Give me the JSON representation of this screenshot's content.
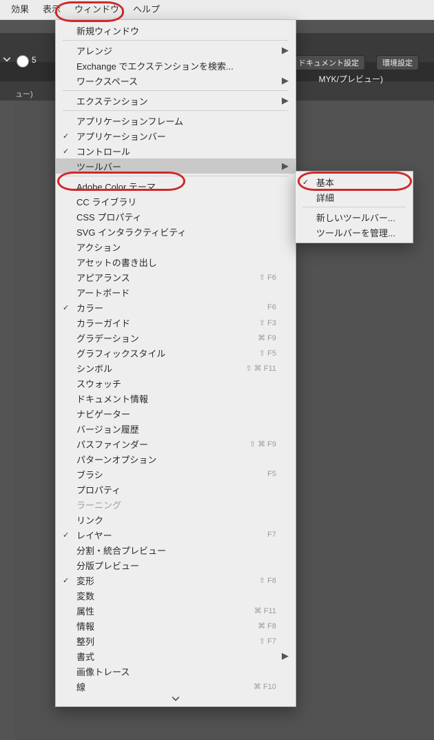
{
  "menubar": {
    "items": [
      "効果",
      "表示",
      "ウィンドウ",
      "ヘルプ"
    ]
  },
  "bg": {
    "doc_setting_btn": "ドキュメント設定",
    "pref_btn": "環境設定",
    "doc_title": "MYK/プレビュー)",
    "tab_text": "ュー)",
    "strok_val": "5"
  },
  "menu": {
    "new_window": "新規ウィンドウ",
    "arrange": "アレンジ",
    "ext_search": "Exchange でエクステンションを検索...",
    "workspace": "ワークスペース",
    "extensions": "エクステンション",
    "app_frame": "アプリケーションフレーム",
    "app_bar": "アプリケーションバー",
    "control": "コントロール",
    "toolbar": "ツールバー",
    "adobe_color": "Adobe Color テーマ",
    "cc_lib": "CC ライブラリ",
    "css_prop": "CSS プロパティ",
    "svg_interactivity": "SVG インタラクティビティ",
    "action": "アクション",
    "asset_export": "アセットの書き出し",
    "appearance": "アピアランス",
    "artboard": "アートボード",
    "color": "カラー",
    "color_guide": "カラーガイド",
    "gradation": "グラデーション",
    "graphic_style": "グラフィックスタイル",
    "symbol": "シンボル",
    "swatch": "スウォッチ",
    "doc_info": "ドキュメント情報",
    "navigator": "ナビゲーター",
    "version_history": "バージョン履歴",
    "pathfinder": "パスファインダー",
    "pattern_option": "パターンオプション",
    "brush": "ブラシ",
    "property": "プロパティ",
    "learning": "ラーニング",
    "link": "リンク",
    "layer": "レイヤー",
    "split_preview": "分割・統合プレビュー",
    "separation_preview": "分版プレビュー",
    "transform": "変形",
    "variables": "変数",
    "attribute": "属性",
    "info": "情報",
    "align": "整列",
    "type": "書式",
    "image_trace": "画像トレース",
    "line": "線",
    "shortcut": {
      "appearance": "⇧ F6",
      "color": "F6",
      "color_guide": "⇧ F3",
      "gradation": "⌘ F9",
      "graphic_style": "⇧ F5",
      "symbol": "⇧ ⌘ F11",
      "pathfinder": "⇧ ⌘ F9",
      "brush": "F5",
      "layer": "F7",
      "transform": "⇧ F8",
      "attribute": "⌘ F11",
      "info": "⌘ F8",
      "align": "⇧ F7",
      "line": "⌘ F10"
    }
  },
  "submenu": {
    "basic": "基本",
    "detail": "詳細",
    "new_toolbar": "新しいツールバー...",
    "manage_toolbar": "ツールバーを管理..."
  }
}
